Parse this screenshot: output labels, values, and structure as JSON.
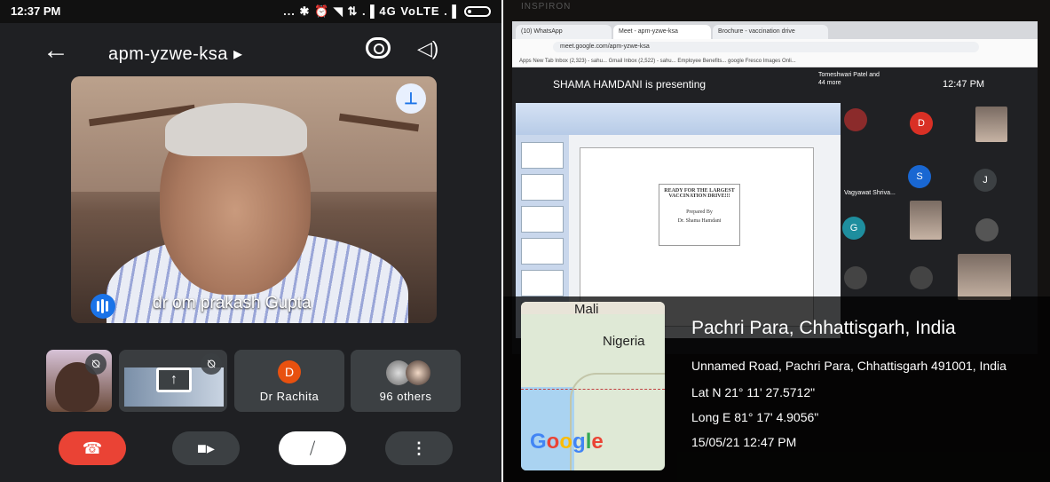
{
  "phone": {
    "status": {
      "time": "12:37 PM",
      "right": "... ✱ ⏰ ◥ ⇅ .▐ 4G VoLTE .▐"
    },
    "topbar": {
      "back": "←",
      "meeting_code": "apm-yzwe-ksa ▸",
      "speaker": "◁)"
    },
    "main_video": {
      "speaker_name": "dr om prakash Gupta",
      "pin": "⊥"
    },
    "tiles": [
      {
        "kind": "self"
      },
      {
        "kind": "screen-share",
        "icon": "↑"
      },
      {
        "kind": "participant",
        "initial": "D",
        "name": "Dr Rachita"
      },
      {
        "kind": "others",
        "name": "96 others"
      }
    ],
    "controls": {
      "end": "☎",
      "video": "■▸",
      "mic": "⧸",
      "more": "⋮"
    }
  },
  "laptop": {
    "brand": "INSPIRON",
    "tabs": [
      "(10) WhatsApp",
      "Meet - apm-yzwe-ksa",
      "Brochure - vaccination drive"
    ],
    "url": "meet.google.com/apm-yzwe-ksa",
    "bookmarks": "Apps  New Tab  Inbox (2,323) - sahu...  Gmail  Inbox (2,522) - sahu...  Employee Benefits...  google  Fresco Images Onli...",
    "meet": {
      "presenting": "SHAMA HAMDANI is presenting",
      "others_label": "Tomeshwari Patel and 44 more",
      "clock": "12:47 PM",
      "slide_title": "READY FOR THE LARGEST VACCINATION DRIVE!!!",
      "slide_byline": "Prepared By",
      "slide_author": "Dr. Shama Hamdani",
      "grid_initials": [
        "D",
        "S",
        "J",
        "G"
      ],
      "grid_name": "Vagyawat Shriva..."
    }
  },
  "geotag": {
    "map_labels": {
      "mali": "Mali",
      "nigeria": "Nigeria",
      "google": "Google"
    },
    "place": "Pachri Para, Chhattisgarh, India",
    "address": "Unnamed Road, Pachri Para, Chhattisgarh 491001, India",
    "lat": "Lat N 21° 11' 27.5712\"",
    "long": "Long E 81° 17' 4.9056\"",
    "datetime": "15/05/21 12:47 PM"
  },
  "colors": {
    "meet_blue": "#1a73e8",
    "end_red": "#ea4335",
    "avatar_orange": "#e8510f"
  }
}
